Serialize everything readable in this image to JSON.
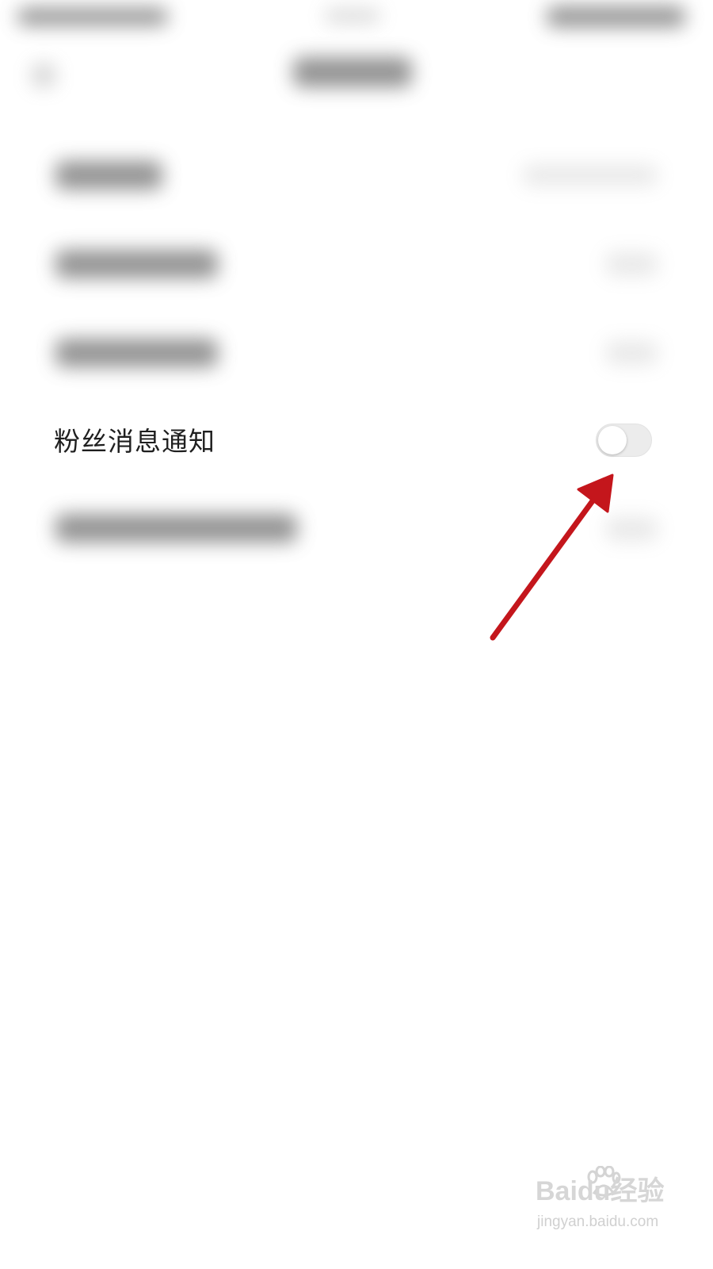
{
  "settings": {
    "fan_notification": {
      "label": "粉丝消息通知",
      "enabled": false
    }
  },
  "colors": {
    "annotation_arrow": "#c4161c",
    "toggle_off_track": "#ececec"
  },
  "watermark": {
    "logo_text": "Baidu经验",
    "url": "jingyan.baidu.com"
  }
}
